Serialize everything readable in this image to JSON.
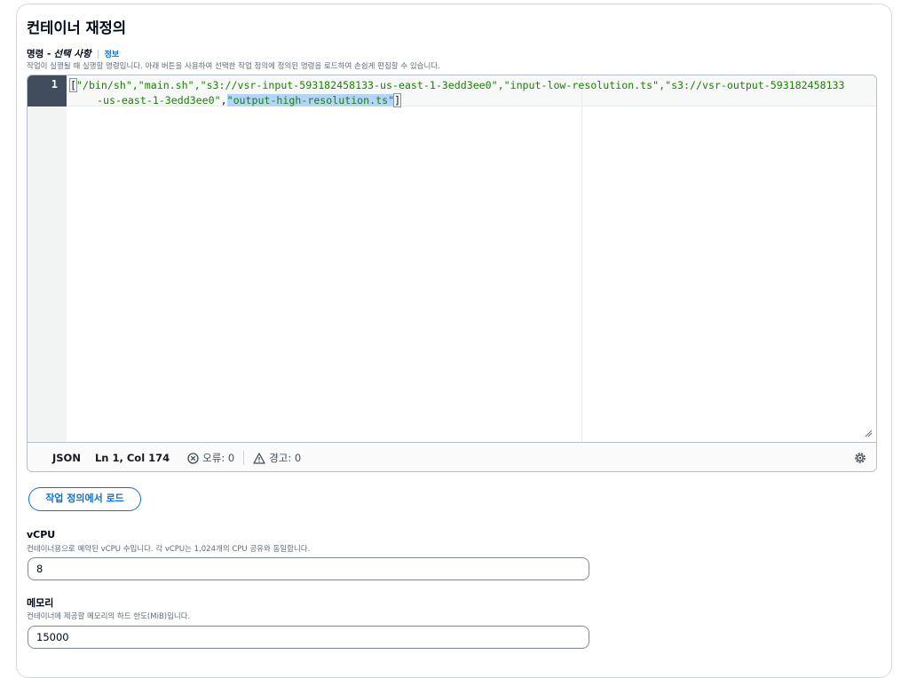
{
  "section": {
    "title": "컨테이너 재정의"
  },
  "command": {
    "label": "명령 - ",
    "optional": "선택 사항",
    "info": "정보",
    "description": "작업이 실행될 때 실행할 명령입니다. 아래 버튼을 사용하여 선택한 작업 정의에 정의된 명령을 로드하여 손쉽게 편집할 수 있습니다.",
    "editor": {
      "line_number": "1",
      "line1_bracket_open": "[",
      "line1_text": "\"/bin/sh\",\"main.sh\",\"s3://vsr-input-593182458133-us-east-1-3edd3ee0\",\"input-low-resolution.ts\",\"s3://vsr-output-593182458133",
      "line2_text": "-us-east-1-3edd3ee0\"",
      "line2_comma": ",",
      "line2_selected": "\"output-high-resolution.ts\"",
      "line2_bracket_close": "]"
    },
    "status": {
      "language": "JSON",
      "position": "Ln 1, Col 174",
      "errors": "오류: 0",
      "warnings": "경고: 0"
    }
  },
  "load_button": "작업 정의에서 로드",
  "vcpu": {
    "label": "vCPU",
    "description": "컨테이너용으로 예약된 vCPU 수입니다. 각 vCPU는 1,024개의 CPU 공유와 동일합니다.",
    "value": "8"
  },
  "memory": {
    "label": "메모리",
    "description": "컨테이너에 제공할 메모리의 하드 한도(MiB)입니다.",
    "value": "15000"
  },
  "colors": {
    "accent": "#0972d3",
    "code_string": "#1d8102",
    "selection": "#b3d4fc",
    "gutter_active": "#414d5c"
  },
  "icons": [
    "info-link",
    "error-circle-icon",
    "warning-triangle-icon",
    "gear-icon",
    "resize-handle-icon"
  ]
}
